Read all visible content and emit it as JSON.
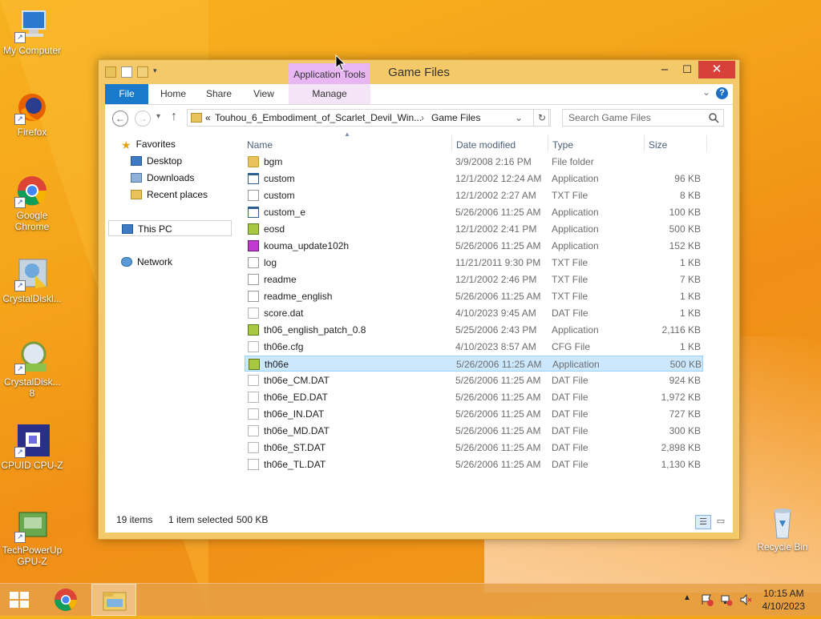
{
  "desktop": {
    "icons": [
      {
        "label": "My Computer",
        "icon": "computer-icon"
      },
      {
        "label": "Firefox",
        "icon": "firefox-icon"
      },
      {
        "label": "Google Chrome",
        "icon": "chrome-icon"
      },
      {
        "label": "CrystalDiskl...",
        "icon": "crystaldiskinfo-icon"
      },
      {
        "label": "CrystalDisk... 8",
        "icon": "crystaldiskmark-icon"
      },
      {
        "label": "CPUID CPU-Z",
        "icon": "cpuz-icon"
      },
      {
        "label": "TechPowerUp GPU-Z",
        "icon": "gpuz-icon"
      },
      {
        "label": "Recycle Bin",
        "icon": "recycle-bin-icon"
      }
    ]
  },
  "window": {
    "title": "Game Files",
    "context_tab_group": "Application Tools",
    "controls": {
      "minimize": "–",
      "maximize": "☐",
      "close": "✕"
    },
    "ribbon_tabs": [
      "File",
      "Home",
      "Share",
      "View",
      "Manage"
    ],
    "help": "?",
    "address": {
      "prefix": "«",
      "parent": "Touhou_6_Embodiment_of_Scarlet_Devil_Win...",
      "separator": "›",
      "current": "Game Files"
    },
    "search_placeholder": "Search Game Files",
    "nav_pane": {
      "favorites": "Favorites",
      "favorites_items": [
        "Desktop",
        "Downloads",
        "Recent places"
      ],
      "this_pc": "This PC",
      "network": "Network"
    },
    "columns": {
      "name": "Name",
      "date": "Date modified",
      "type": "Type",
      "size": "Size"
    },
    "files": [
      {
        "name": "bgm",
        "date": "3/9/2008 2:16 PM",
        "type": "File folder",
        "size": "",
        "icon": "folder"
      },
      {
        "name": "custom",
        "date": "12/1/2002 12:24 AM",
        "type": "Application",
        "size": "96 KB",
        "icon": "app"
      },
      {
        "name": "custom",
        "date": "12/1/2002 2:27 AM",
        "type": "TXT File",
        "size": "8 KB",
        "icon": "txt"
      },
      {
        "name": "custom_e",
        "date": "5/26/2006 11:25 AM",
        "type": "Application",
        "size": "100 KB",
        "icon": "app"
      },
      {
        "name": "eosd",
        "date": "12/1/2002 2:41 PM",
        "type": "Application",
        "size": "500 KB",
        "icon": "game"
      },
      {
        "name": "kouma_update102h",
        "date": "5/26/2006 11:25 AM",
        "type": "Application",
        "size": "152 KB",
        "icon": "inst"
      },
      {
        "name": "log",
        "date": "11/21/2011 9:30 PM",
        "type": "TXT File",
        "size": "1 KB",
        "icon": "txt"
      },
      {
        "name": "readme",
        "date": "12/1/2002 2:46 PM",
        "type": "TXT File",
        "size": "7 KB",
        "icon": "txt"
      },
      {
        "name": "readme_english",
        "date": "5/26/2006 11:25 AM",
        "type": "TXT File",
        "size": "1 KB",
        "icon": "txt"
      },
      {
        "name": "score.dat",
        "date": "4/10/2023 9:45 AM",
        "type": "DAT File",
        "size": "1 KB",
        "icon": "dat"
      },
      {
        "name": "th06_english_patch_0.8",
        "date": "5/25/2006 2:43 PM",
        "type": "Application",
        "size": "2,116 KB",
        "icon": "game"
      },
      {
        "name": "th06e.cfg",
        "date": "4/10/2023 8:57 AM",
        "type": "CFG File",
        "size": "1 KB",
        "icon": "dat"
      },
      {
        "name": "th06e",
        "date": "5/26/2006 11:25 AM",
        "type": "Application",
        "size": "500 KB",
        "icon": "game",
        "selected": true
      },
      {
        "name": "th06e_CM.DAT",
        "date": "5/26/2006 11:25 AM",
        "type": "DAT File",
        "size": "924 KB",
        "icon": "dat"
      },
      {
        "name": "th06e_ED.DAT",
        "date": "5/26/2006 11:25 AM",
        "type": "DAT File",
        "size": "1,972 KB",
        "icon": "dat"
      },
      {
        "name": "th06e_IN.DAT",
        "date": "5/26/2006 11:25 AM",
        "type": "DAT File",
        "size": "727 KB",
        "icon": "dat"
      },
      {
        "name": "th06e_MD.DAT",
        "date": "5/26/2006 11:25 AM",
        "type": "DAT File",
        "size": "300 KB",
        "icon": "dat"
      },
      {
        "name": "th06e_ST.DAT",
        "date": "5/26/2006 11:25 AM",
        "type": "DAT File",
        "size": "2,898 KB",
        "icon": "dat"
      },
      {
        "name": "th06e_TL.DAT",
        "date": "5/26/2006 11:25 AM",
        "type": "DAT File",
        "size": "1,130 KB",
        "icon": "dat"
      }
    ],
    "status": {
      "items": "19 items",
      "selection": "1 item selected",
      "selection_size": "500 KB"
    }
  },
  "taskbar": {
    "time": "10:15 AM",
    "date": "4/10/2023"
  }
}
